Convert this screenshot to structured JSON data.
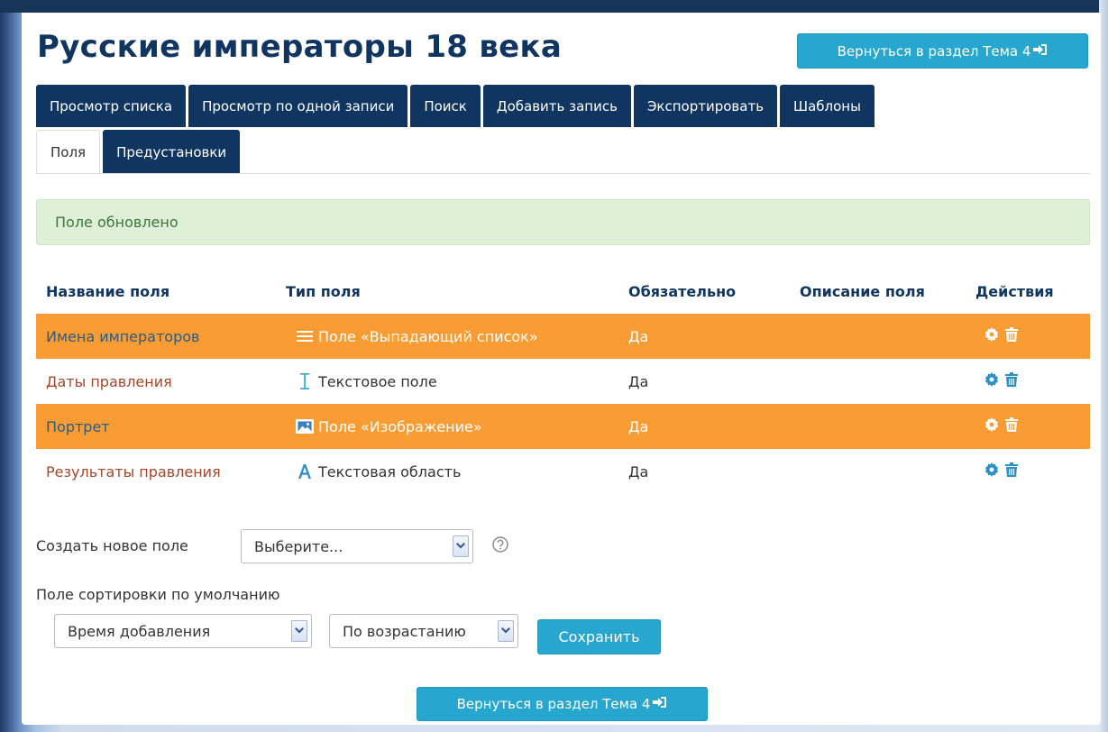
{
  "page": {
    "title": "Русские императоры 18 века",
    "return_button": "Вернуться в раздел Тема 4",
    "return_button_icon": "sign-in-icon"
  },
  "tabs_primary": [
    {
      "label": "Просмотр списка"
    },
    {
      "label": "Просмотр по одной записи"
    },
    {
      "label": "Поиск"
    },
    {
      "label": "Добавить запись"
    },
    {
      "label": "Экспортировать"
    },
    {
      "label": "Шаблоны"
    }
  ],
  "tabs_secondary": [
    {
      "label": "Поля",
      "active": true
    },
    {
      "label": "Предустановки",
      "active": false
    }
  ],
  "alert": {
    "message": "Поле обновлено",
    "color": "#dff0d8"
  },
  "table": {
    "headers": [
      "Название поля",
      "Тип поля",
      "Обязательно",
      "Описание поля",
      "Действия"
    ],
    "rows": [
      {
        "name": "Имена императоров",
        "type": "Поле «Выпадающий список»",
        "type_icon": "list-icon",
        "required": "Да",
        "description": "",
        "highlighted": true
      },
      {
        "name": "Даты правления",
        "type": "Текстовое поле",
        "type_icon": "text-cursor-icon",
        "required": "Да",
        "description": "",
        "highlighted": false
      },
      {
        "name": "Портрет",
        "type": "Поле «Изображение»",
        "type_icon": "picture-icon",
        "required": "Да",
        "description": "",
        "highlighted": true
      },
      {
        "name": "Результаты правления",
        "type": "Текстовая область",
        "type_icon": "text-area-icon",
        "required": "Да",
        "description": "",
        "highlighted": false
      }
    ],
    "action_icons": [
      "gear-icon",
      "trash-icon"
    ],
    "highlight_color": "#f99c33"
  },
  "create_field": {
    "label": "Создать новое поле",
    "selected": "Выберите..."
  },
  "sort": {
    "label": "Поле сортировки по умолчанию",
    "field_selected": "Время добавления",
    "order_selected": "По возрастанию",
    "save_label": "Сохранить"
  },
  "colors": {
    "brand_dark": "#0f3560",
    "accent": "#27a7cf"
  }
}
